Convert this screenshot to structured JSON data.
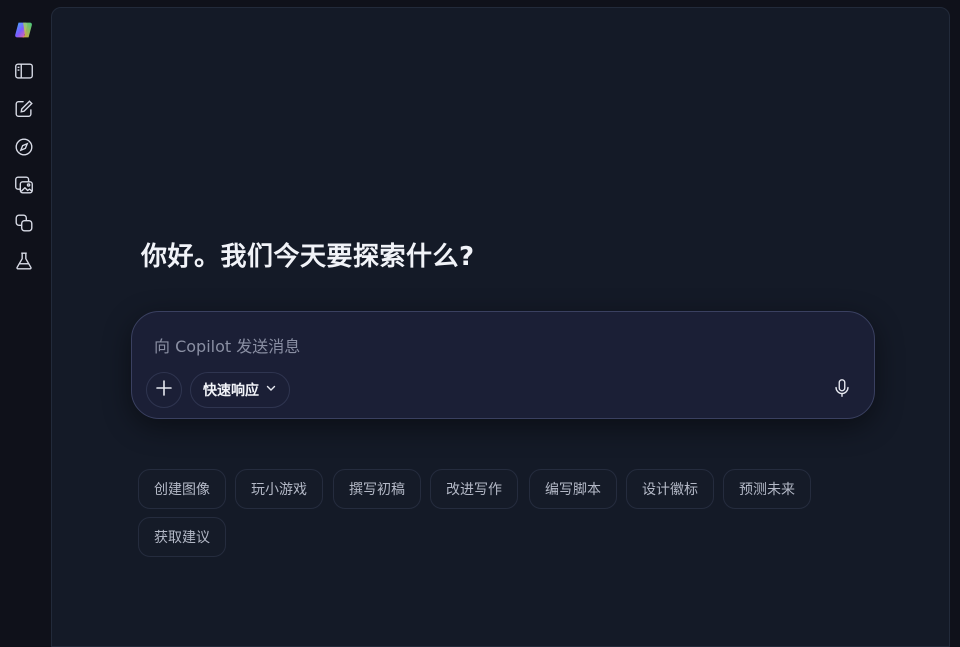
{
  "sidebar": {
    "items": [
      {
        "icon": "copilot-logo-icon"
      },
      {
        "icon": "sidebar-toggle-icon"
      },
      {
        "icon": "new-chat-icon"
      },
      {
        "icon": "discover-compass-icon"
      },
      {
        "icon": "image-gallery-icon"
      },
      {
        "icon": "pages-copy-icon"
      },
      {
        "icon": "labs-flask-icon"
      }
    ]
  },
  "main": {
    "greeting": "你好。我们今天要探索什么?",
    "composer": {
      "placeholder": "向 Copilot 发送消息",
      "value": "",
      "mode_label": "快速响应",
      "icons": {
        "add": "plus-icon",
        "mode": "chevron-down-icon",
        "voice": "microphone-icon"
      }
    },
    "suggestions": [
      "创建图像",
      "玩小游戏",
      "撰写初稿",
      "改进写作",
      "编写脚本",
      "设计徽标",
      "预测未来",
      "获取建议"
    ]
  },
  "colors": {
    "background": "#0f111a",
    "panel": "#141a27",
    "composer": "#1b1f36",
    "text": "#f1f3f8",
    "muted": "#b3b8c6"
  }
}
